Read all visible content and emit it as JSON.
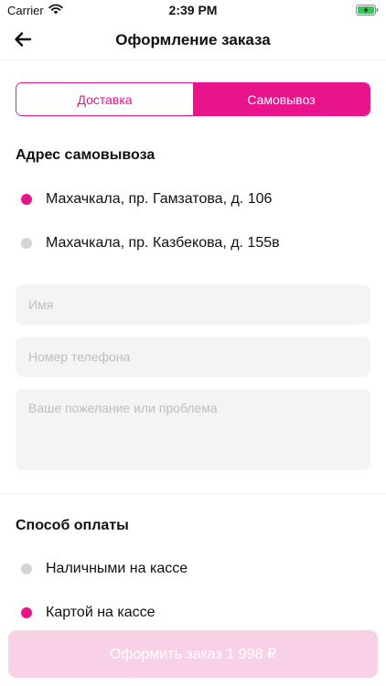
{
  "status_bar": {
    "carrier": "Carrier",
    "time": "2:39 PM"
  },
  "nav": {
    "title": "Оформление заказа",
    "back_icon": "arrow-left-icon"
  },
  "delivery_tabs": {
    "tabs": [
      "Доставка",
      "Самовывоз"
    ],
    "selected": "Самовывоз"
  },
  "pickup": {
    "title": "Адрес самовывоза",
    "addresses": [
      {
        "label": "Махачкала, пр. Гамзатова, д. 106",
        "selected": true
      },
      {
        "label": "Махачкала, пр. Казбекова, д. 155в",
        "selected": false
      }
    ]
  },
  "form": {
    "name_placeholder": "Имя",
    "phone_placeholder": "Номер телефона",
    "comment_placeholder": "Ваше пожелание или проблема"
  },
  "payment": {
    "title": "Способ оплаты",
    "options": [
      {
        "label": "Наличными на кассе",
        "selected": false
      },
      {
        "label": "Картой на кассе",
        "selected": true
      }
    ]
  },
  "submit": {
    "label": "Оформить заказ 1 998 ₽"
  },
  "colors": {
    "accent": "#e8148c",
    "accent_disabled": "#f8d1e6",
    "radio_off": "#d4d4d4",
    "field_bg": "#f4f4f5"
  }
}
